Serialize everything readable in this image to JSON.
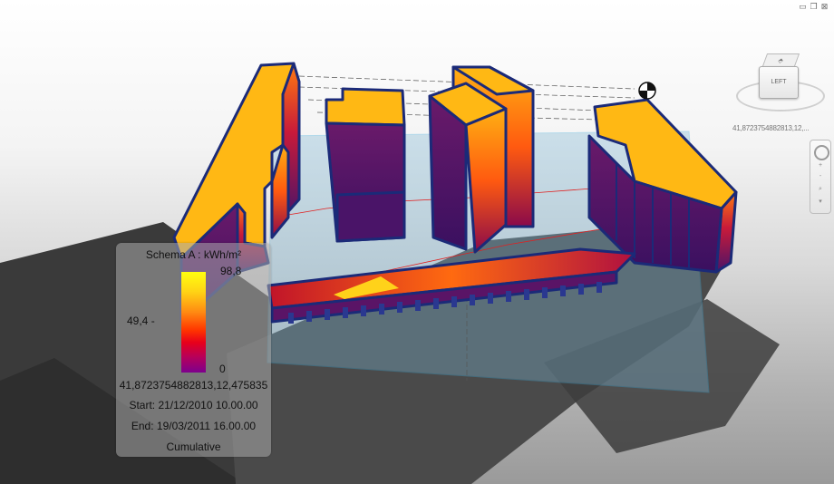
{
  "window": {
    "minimize_glyph": "▭",
    "restore_glyph": "❐",
    "close_glyph": "⊠"
  },
  "viewcube": {
    "face_label": "LEFT",
    "top_glyph": "⬘",
    "coordinate_readout": "41,8723754882813,12,..."
  },
  "navbar": {
    "zoom_in_glyph": "+",
    "zoom_out_glyph": "-",
    "zoom_glyph": "⌕",
    "more_glyph": "▾"
  },
  "legend": {
    "title": "Schema A : kWh/m²",
    "max_value": "98,8",
    "mid_value": "49,4 -",
    "min_value": "0",
    "location": "41,8723754882813,12,475835",
    "start": "Start: 21/12/2010 10.00.00",
    "end": "End: 19/03/2011 16.00.00",
    "mode": "Cumulative"
  },
  "colors": {
    "building_outline": "#1b2a78",
    "high": "#ffd21a",
    "peak": "#ff8a10",
    "low": "#4a1468",
    "ground_plane": "#7bb4d2",
    "shadow": "#3a3a3a"
  },
  "chart_data": {
    "type": "heatmap",
    "title": "Schema A : kWh/m²",
    "scale_min": 0,
    "scale_mid": 49.4,
    "scale_max": 98.8,
    "unit": "kWh/m²",
    "period_start": "21/12/2010 10.00.00",
    "period_end": "19/03/2011 16.00.00",
    "mode": "Cumulative"
  }
}
